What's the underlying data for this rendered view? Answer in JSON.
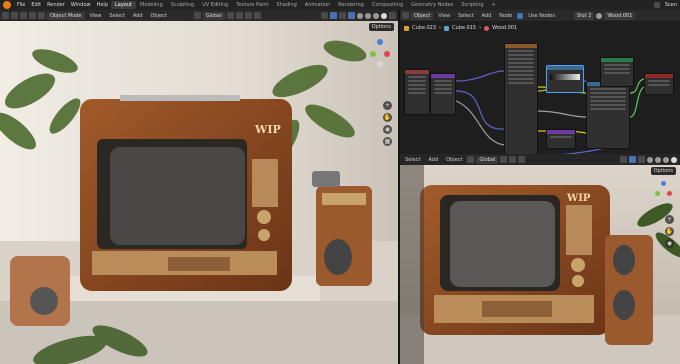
{
  "topbar": {
    "menus": [
      "File",
      "Edit",
      "Render",
      "Window",
      "Help"
    ],
    "workspaces": [
      "Layout",
      "Modeling",
      "Sculpting",
      "UV Editing",
      "Texture Paint",
      "Shading",
      "Animation",
      "Rendering",
      "Compositing",
      "Geometry Nodes",
      "Scripting"
    ],
    "active_workspace": "Layout",
    "add_tab": "+",
    "scene_label": "Scen"
  },
  "left_viewport": {
    "mode": "Object Mode",
    "menus": [
      "View",
      "Select",
      "Add",
      "Object"
    ],
    "transform": "Global",
    "options": "Options",
    "tv_badge": "WIP"
  },
  "node_editor": {
    "type": "Object",
    "menus": [
      "View",
      "Select",
      "Add",
      "Node"
    ],
    "use_nodes_label": "Use Nodes",
    "slot": "Slot 2",
    "material": "Wood.001",
    "breadcrumb": [
      "Cube.023",
      "Cube.015",
      "Wood.001"
    ]
  },
  "right_viewport": {
    "menus": [
      "Select",
      "Add",
      "Object"
    ],
    "transform": "Global",
    "options": "Options",
    "tv_badge": "WIP"
  },
  "colors": {
    "accent": "#4772b3",
    "blender_orange": "#e87d0d",
    "wood": "#8a4a24"
  }
}
